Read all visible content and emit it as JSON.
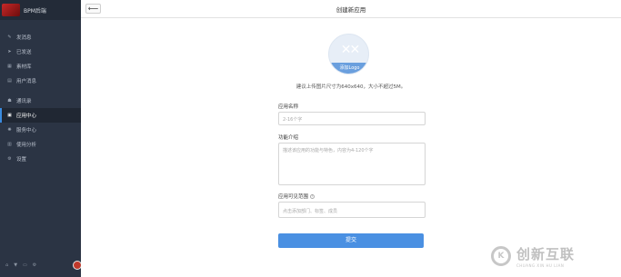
{
  "sidebar": {
    "brand_name": "BPM后端",
    "items": [
      {
        "icon": "pencil-icon",
        "glyph": "✎",
        "label": "发消息"
      },
      {
        "icon": "send-icon",
        "glyph": "➤",
        "label": "已发送"
      },
      {
        "icon": "library-icon",
        "glyph": "▦",
        "label": "素材库"
      },
      {
        "icon": "user-msg-icon",
        "glyph": "▤",
        "label": "用户消息"
      },
      {
        "icon": "contacts-icon",
        "glyph": "☗",
        "label": "通讯录"
      },
      {
        "icon": "apps-icon",
        "glyph": "▣",
        "label": "应用中心"
      },
      {
        "icon": "service-icon",
        "glyph": "✺",
        "label": "服务中心"
      },
      {
        "icon": "chart-icon",
        "glyph": "▥",
        "label": "使用分析"
      },
      {
        "icon": "settings-icon",
        "glyph": "⚙",
        "label": "设置"
      }
    ],
    "active_label": "应用中心",
    "footer_icons": [
      "home-icon",
      "cart-icon",
      "doc-icon",
      "gear-icon"
    ]
  },
  "header": {
    "back_glyph": "⟵",
    "title": "创建新应用"
  },
  "form": {
    "upload_label": "添加Logo",
    "upload_hint": "建议上传图片尺寸为640x640，大小不超过5M。",
    "name_label": "应用名称",
    "name_placeholder": "2-16个字",
    "intro_label": "功能介绍",
    "intro_placeholder": "描述该应用的功能与特色，内容为4-120个字",
    "scope_label": "应用可见范围",
    "scope_placeholder": "点击添加部门、标签、成员",
    "submit_label": "提交"
  },
  "watermark": {
    "cn": "创新互联",
    "en": "CHUANG XIN HU LIAN",
    "logo_glyph": "K"
  },
  "colors": {
    "sidebar_bg": "#2b3444",
    "accent": "#4a90e2"
  }
}
